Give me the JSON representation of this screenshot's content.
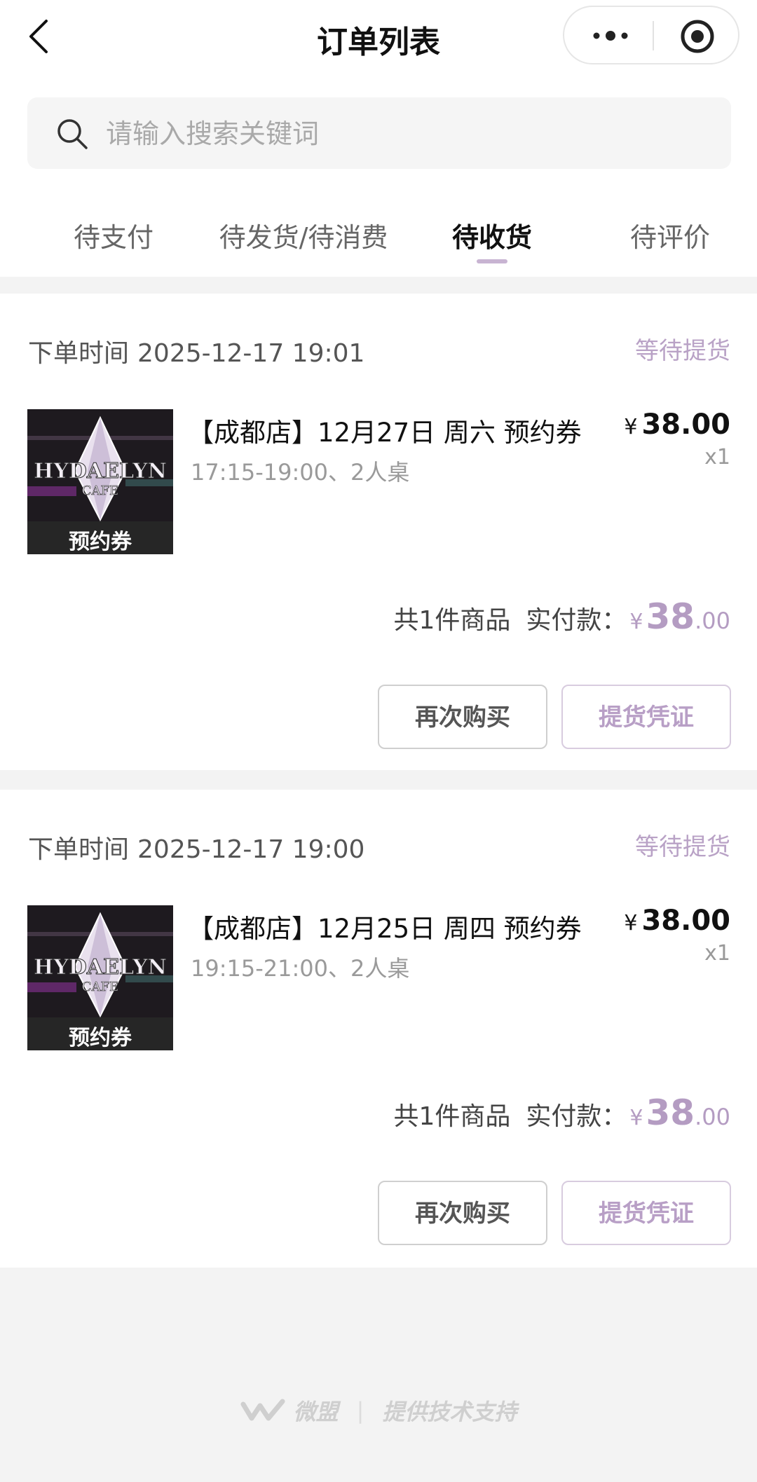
{
  "header": {
    "title": "订单列表"
  },
  "search": {
    "placeholder": "请输入搜索关键词"
  },
  "tabs": [
    {
      "label": "待支付"
    },
    {
      "label": "待发货/待消费"
    },
    {
      "label": "待收货",
      "active": true
    },
    {
      "label": "待评价"
    }
  ],
  "orders": [
    {
      "time_label": "下单时间",
      "time": "2025-12-17 19:01",
      "status": "等待提货",
      "thumb_caption": "预约券",
      "product_name": "【成都店】12月27日 周六 预约券",
      "product_sub": "17:15-19:00、2人桌",
      "currency": "¥",
      "price": "38.00",
      "qty": "x1",
      "count_text": "共1件商品",
      "paid_label": "实付款：",
      "paid_int": "38",
      "paid_dec": ".00",
      "btn_rebuy": "再次购买",
      "btn_voucher": "提货凭证"
    },
    {
      "time_label": "下单时间",
      "time": "2025-12-17 19:00",
      "status": "等待提货",
      "thumb_caption": "预约券",
      "product_name": "【成都店】12月25日 周四 预约券",
      "product_sub": "19:15-21:00、2人桌",
      "currency": "¥",
      "price": "38.00",
      "qty": "x1",
      "count_text": "共1件商品",
      "paid_label": "实付款：",
      "paid_int": "38",
      "paid_dec": ".00",
      "btn_rebuy": "再次购买",
      "btn_voucher": "提货凭证"
    }
  ],
  "footer": {
    "brand": "微盟",
    "text": "提供技术支持"
  },
  "colors": {
    "accent": "#b89fc6",
    "background": "#f3f3f3"
  }
}
